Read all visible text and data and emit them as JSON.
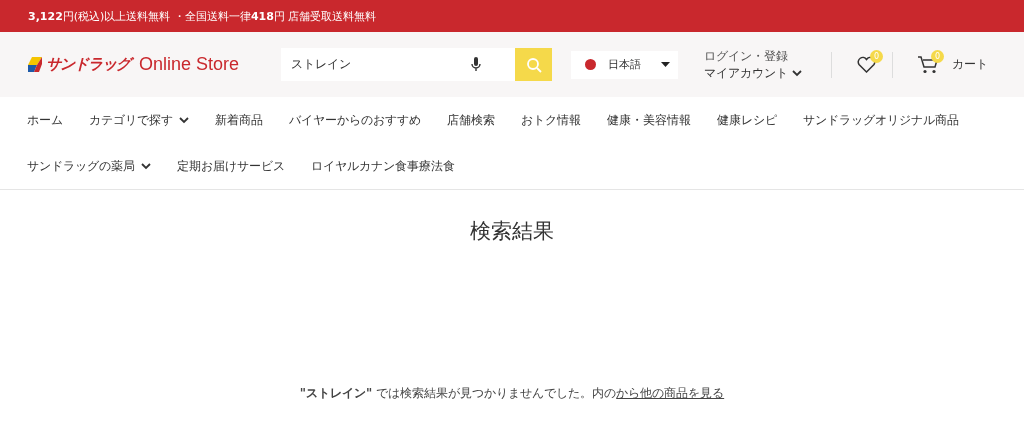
{
  "announcement": "**3,122**円(税込)以上送料無料 ・全国送料一律**418**円 店舗受取送料無料",
  "header": {
    "logo": {
      "brand": "サンドラッグ",
      "suffix": "Online Store"
    },
    "search": {
      "value": "ストレイン"
    },
    "language": {
      "label": "日本語"
    },
    "account": {
      "top": "ログイン・登録",
      "label": "マイアカウント"
    },
    "wishlist": {
      "count": "0"
    },
    "cart": {
      "count": "0",
      "label": "カート"
    }
  },
  "nav": [
    {
      "label": "ホーム",
      "has_menu": false
    },
    {
      "label": "カテゴリで探す",
      "has_menu": true
    },
    {
      "label": "新着商品",
      "has_menu": false
    },
    {
      "label": "バイヤーからのおすすめ",
      "has_menu": false
    },
    {
      "label": "店舗検索",
      "has_menu": false
    },
    {
      "label": "おトク情報",
      "has_menu": false
    },
    {
      "label": "健康・美容情報",
      "has_menu": false
    },
    {
      "label": "健康レシピ",
      "has_menu": false
    },
    {
      "label": "サンドラッグオリジナル商品",
      "has_menu": false
    },
    {
      "label": "サンドラッグの薬局",
      "has_menu": true
    },
    {
      "label": "定期お届けサービス",
      "has_menu": false
    },
    {
      "label": "ロイヤルカナン食事療法食",
      "has_menu": false
    }
  ],
  "results": {
    "title": "検索結果",
    "message": "**\"ストレイン\"** では検索結果が見つかりませんでした。内の",
    "link": "から他の商品を見る"
  }
}
